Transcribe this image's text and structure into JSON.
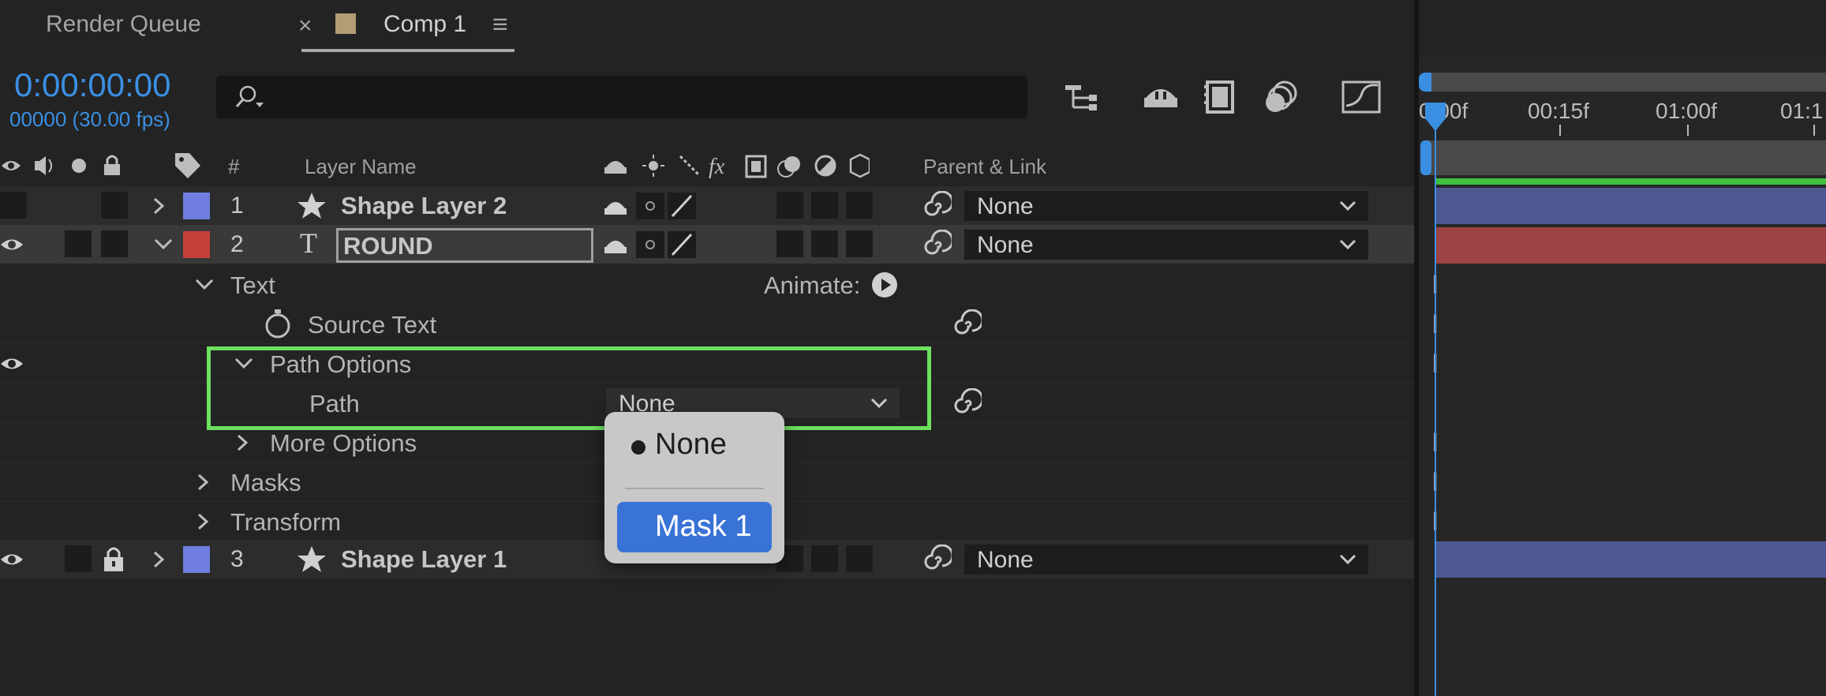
{
  "tabs": [
    {
      "label": "Render Queue"
    },
    {
      "label": "Comp 1",
      "close": "×",
      "menu": "≡"
    }
  ],
  "time": {
    "timecode": "0:00:00:00",
    "frames": "00000 (30.00 fps)"
  },
  "search": {
    "placeholder": ""
  },
  "columns": {
    "number": "#",
    "layer_name": "Layer Name",
    "parent": "Parent & Link"
  },
  "layers": [
    {
      "num": "1",
      "name": "Shape Layer 2",
      "parent": "None",
      "color": "#6f7ee0"
    },
    {
      "num": "2",
      "name": "ROUND",
      "parent": "None",
      "color": "#c6403a"
    },
    {
      "num": "3",
      "name": "Shape Layer 1",
      "parent": "None",
      "color": "#6f7ee0"
    }
  ],
  "props": {
    "text": "Text",
    "animate": "Animate:",
    "source_text": "Source Text",
    "path_options": "Path Options",
    "path": "Path",
    "path_value": "None",
    "more_options": "More Options",
    "masks": "Masks",
    "transform": "Transform"
  },
  "popup": {
    "items": [
      "None",
      "Mask 1"
    ],
    "selected": "Mask 1",
    "checked": "None"
  },
  "ruler": {
    "t0": "0:00f",
    "t1": "00:15f",
    "t2": "01:00f",
    "t3": "01:1"
  },
  "colors": {
    "accent": "#3a8fe3",
    "highlight": "#6de05f",
    "menu_selected": "#3a73d6"
  }
}
